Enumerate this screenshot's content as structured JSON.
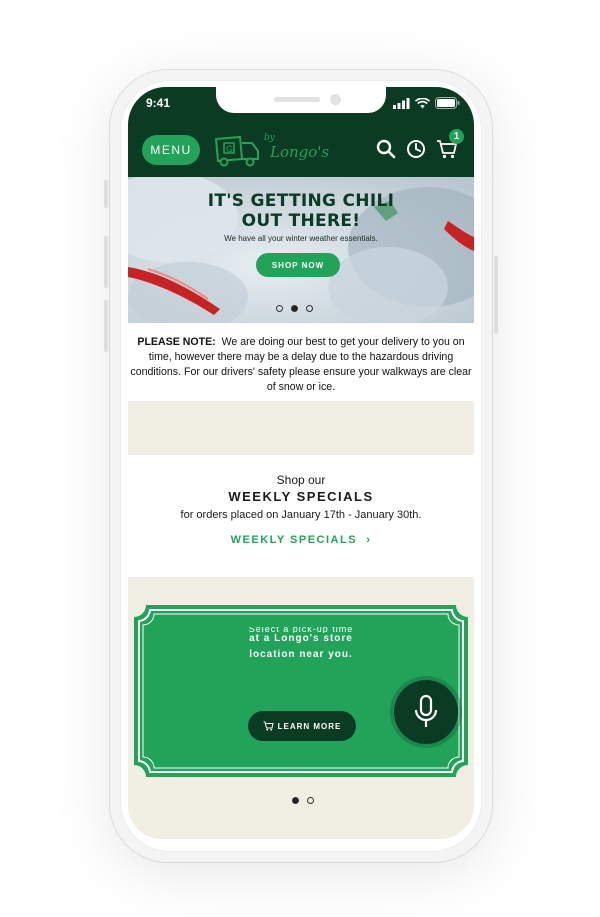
{
  "status_bar": {
    "time": "9:41"
  },
  "header": {
    "menu_label": "MENU",
    "logo_by": "by",
    "logo_brand": "Longo's",
    "cart_count": "1",
    "icons": [
      "search-icon",
      "clock-icon",
      "cart-icon"
    ]
  },
  "hero": {
    "title_line1": "IT'S GETTING CHILI",
    "title_line2": "OUT THERE!",
    "subtitle": "We have all your winter weather essentials.",
    "button_label": "SHOP NOW",
    "carousel_pages": 3,
    "active_page": 2
  },
  "notice": {
    "label": "PLEASE NOTE:",
    "text": "We are doing our best to get your delivery to you on time, however there may be a delay due to the hazardous driving conditions.  For our drivers' safety please ensure your walkways are clear of snow or ice."
  },
  "weekly": {
    "pre_title": "Shop our",
    "title": "WEEKLY SPECIALS",
    "dates": "for orders placed on January 17th - January 30th.",
    "link_label": "WEEKLY SPECIALS",
    "link_chevron": "›"
  },
  "promo": {
    "line_partial": "Select a pick-up time",
    "line2": "at a Longo's store",
    "line3": "location near you.",
    "button_label": "LEARN MORE",
    "carousel_pages": 2,
    "active_page": 1
  },
  "colors": {
    "dark_green": "#0b3b22",
    "accent_green": "#22a35a",
    "cream": "#f1efe4"
  }
}
